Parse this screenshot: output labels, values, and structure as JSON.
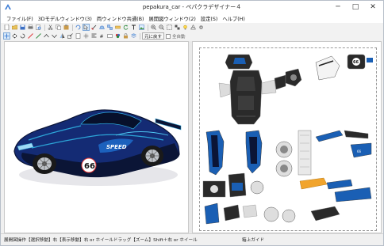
{
  "window": {
    "title": "pepakura_car - ペパクラデザイナー４",
    "minimize_glyph": "─",
    "maximize_glyph": "□",
    "close_glyph": "✕"
  },
  "menu": [
    {
      "label": "ファイル(F)"
    },
    {
      "label": "3Dモデルウィンドウ(3)"
    },
    {
      "label": "両ウィンドウ共通(B)"
    },
    {
      "label": "展開図ウィンドウ(2)"
    },
    {
      "label": "設定(S)"
    },
    {
      "label": "ヘルプ(H)"
    }
  ],
  "toolbar": {
    "undo_label": "元に戻す",
    "all_select_label": "全自動"
  },
  "status": {
    "left_text": "展開図操作【選択移動】右【表示移動】右 or ホイールドラッグ【ズーム】Shift＋右 or ホイール",
    "right_text": "箱上ガイド"
  },
  "car": {
    "number": "66",
    "brand_text": "SPEED"
  },
  "colors": {
    "car_body": "#142b74",
    "car_dark": "#0b1536",
    "accent": "#2ca5d8",
    "part_dark": "#2a2a2a",
    "part_blue": "#1a5fb4",
    "window_frame": "#b7bfc9"
  }
}
